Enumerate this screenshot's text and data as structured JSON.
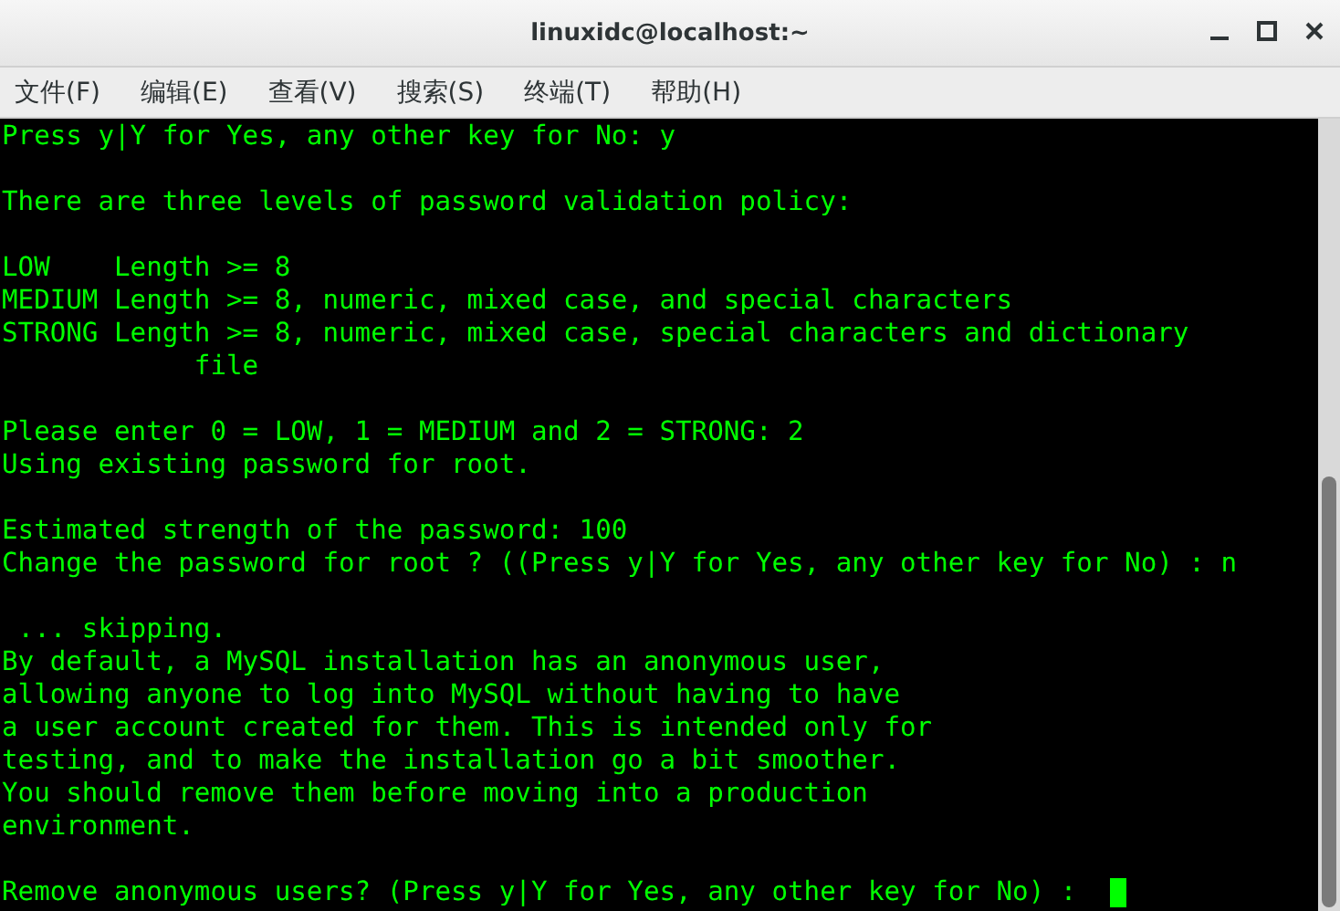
{
  "window": {
    "title": "linuxidc@localhost:~"
  },
  "menu": [
    {
      "label": "文件(F)"
    },
    {
      "label": "编辑(E)"
    },
    {
      "label": "查看(V)"
    },
    {
      "label": "搜索(S)"
    },
    {
      "label": "终端(T)"
    },
    {
      "label": "帮助(H)"
    }
  ],
  "terminal": {
    "cursor": true,
    "blocks": [
      [
        "Press y|Y for Yes, any other key for No: y"
      ],
      [
        "There are three levels of password validation policy:"
      ],
      [
        "LOW    Length >= 8",
        "MEDIUM Length >= 8, numeric, mixed case, and special characters",
        "STRONG Length >= 8, numeric, mixed case, special characters and dictionary",
        "            file"
      ],
      [
        "Please enter 0 = LOW, 1 = MEDIUM and 2 = STRONG: 2",
        "Using existing password for root."
      ],
      [
        "Estimated strength of the password: 100",
        "Change the password for root ? ((Press y|Y for Yes, any other key for No) : n"
      ],
      [
        " ... skipping.",
        "By default, a MySQL installation has an anonymous user,",
        "allowing anyone to log into MySQL without having to have",
        "a user account created for them. This is intended only for",
        "testing, and to make the installation go a bit smoother.",
        "You should remove them before moving into a production",
        "environment."
      ],
      [
        "Remove anonymous users? (Press y|Y for Yes, any other key for No) :"
      ]
    ]
  }
}
